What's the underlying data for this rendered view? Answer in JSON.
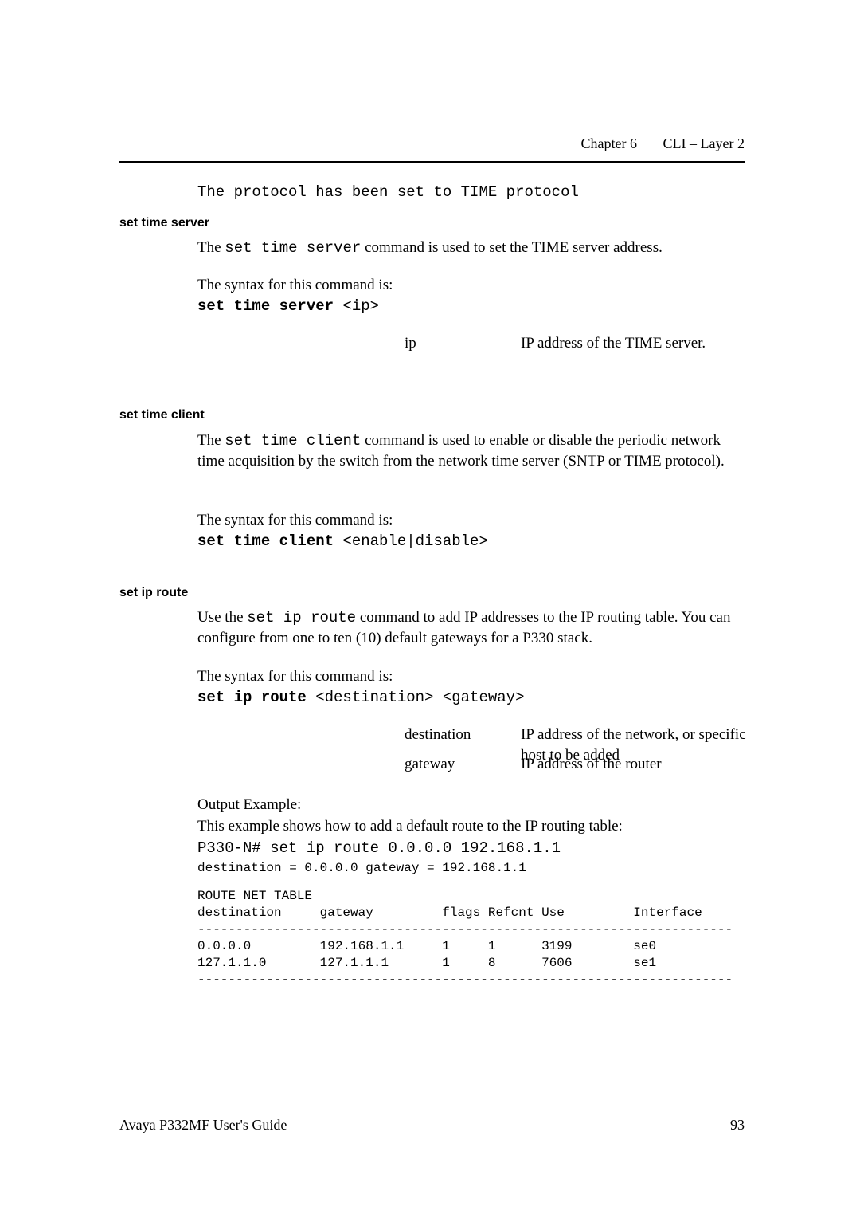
{
  "header": {
    "chapter_label": "Chapter 6",
    "chapter_title": "CLI – Layer 2"
  },
  "top_code_line": "The protocol has been set to TIME protocol",
  "sections": {
    "server": {
      "heading": "set time server",
      "p1_pre": "The ",
      "p1_cmd": "set time server",
      "p1_post": " command is used to set the TIME server address.",
      "syntax_intro": "The syntax for this command is:",
      "cmd_bold": "set time server",
      "cmd_arg": " <ip>",
      "ip_term": "ip",
      "ip_desc": "IP address of the TIME server."
    },
    "client": {
      "heading": "set time client",
      "p1_pre": "The ",
      "p1_cmd": "set time client",
      "p1_post": " command is used to enable or disable the periodic network time acquisition by the switch from the network time server (SNTP or TIME protocol).",
      "syntax_intro": "The syntax for this command is:",
      "cmd_bold": "set time client",
      "cmd_arg": " <enable|disable>"
    },
    "iproute": {
      "heading": "set ip route",
      "p1_pre": "Use the ",
      "p1_cmd": "set ip route",
      "p1_post": " command to add IP addresses to the IP routing table. You can configure from one to ten (10) default gateways for a P330 stack.",
      "syntax_intro": "The syntax for this command is:",
      "cmd_bold": "set ip route",
      "cmd_arg": " <destination> <gateway>",
      "dest_term": "destination",
      "dest_desc": "IP address of the network, or specific host to be added",
      "gate_term": "gateway",
      "gate_desc": "IP address of the router",
      "oe_title": "Output Example:",
      "oe_desc": "This example shows how to add a default route to the IP routing table:",
      "oe_cmd": "P330-N# set ip route 0.0.0.0 192.168.1.1",
      "oe_result": "destination = 0.0.0.0  gateway = 192.168.1.1"
    }
  },
  "route_table": {
    "title": "ROUTE NET TABLE",
    "header_line": "destination     gateway         flags Refcnt Use         Interface",
    "divider": "----------------------------------------------------------------------",
    "row1": "0.0.0.0         192.168.1.1     1     1      3199        se0",
    "row2": "127.1.1.0       127.1.1.1       1     8      7606        se1"
  },
  "footer": {
    "left": "Avaya P332MF User's Guide",
    "right": "93"
  }
}
